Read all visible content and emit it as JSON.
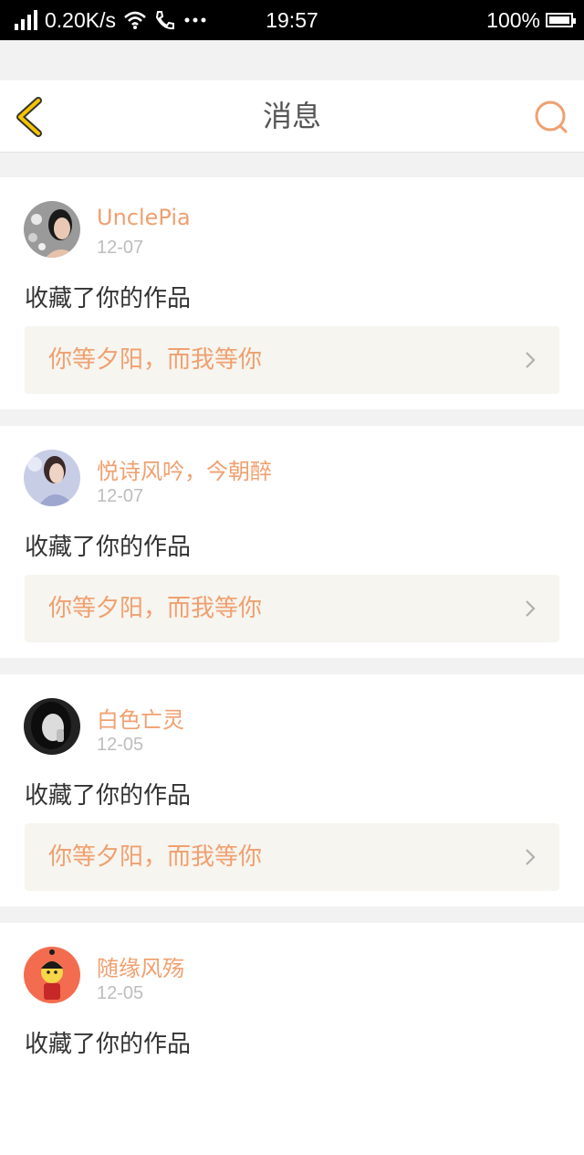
{
  "status_bar": {
    "speed": "0.20K/s",
    "time": "19:57",
    "battery": "100%",
    "icons": [
      "signal-icon",
      "wifi-icon",
      "call-icon",
      "more-icon",
      "battery-icon"
    ]
  },
  "header": {
    "title": "消息",
    "back_icon": "back-icon",
    "search_icon": "search-icon"
  },
  "colors": {
    "accent": "#f0a070",
    "back": "#f5c400",
    "card_work_bg": "#f6f5ef"
  },
  "messages": [
    {
      "user": "UnclePia",
      "date": "12-07",
      "action": "收藏了你的作品",
      "work": "你等夕阳，而我等你"
    },
    {
      "user": "悦诗风吟，今朝醉",
      "date": "12-07",
      "action": "收藏了你的作品",
      "work": "你等夕阳，而我等你"
    },
    {
      "user": "白色亡灵",
      "date": "12-05",
      "action": "收藏了你的作品",
      "work": "你等夕阳，而我等你"
    },
    {
      "user": "随缘风殇",
      "date": "12-05",
      "action": "收藏了你的作品",
      "work": ""
    }
  ]
}
